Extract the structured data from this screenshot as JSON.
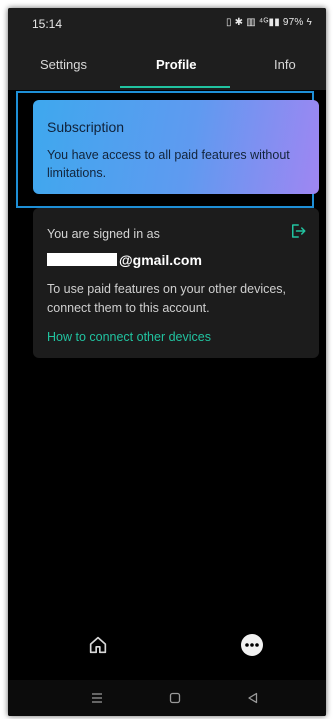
{
  "status_bar": {
    "time": "15:14",
    "indicators": "▯ ✱ ▥ ⁴ᴳ▮▮ 97% ϟ"
  },
  "tabs": [
    {
      "label": "Settings"
    },
    {
      "label": "Profile",
      "active": true
    },
    {
      "label": "Info"
    }
  ],
  "subscription": {
    "title": "Subscription",
    "text": "You have access to all paid features without limitations."
  },
  "account": {
    "signed_in_label": "You are signed in as",
    "email_visible": "@gmail.com",
    "info": "To use paid features on your other devices, connect them to this account.",
    "link": "How to connect other devices"
  },
  "bottom_nav": {
    "home_icon": "home-icon",
    "more_icon": "more-icon"
  },
  "system_nav": {
    "menu_icon": "menu-icon",
    "home_icon": "square-home-icon",
    "back_icon": "back-triangle-icon"
  },
  "colors": {
    "accent": "#21c3a0",
    "highlight_border": "#1e8fd6"
  }
}
